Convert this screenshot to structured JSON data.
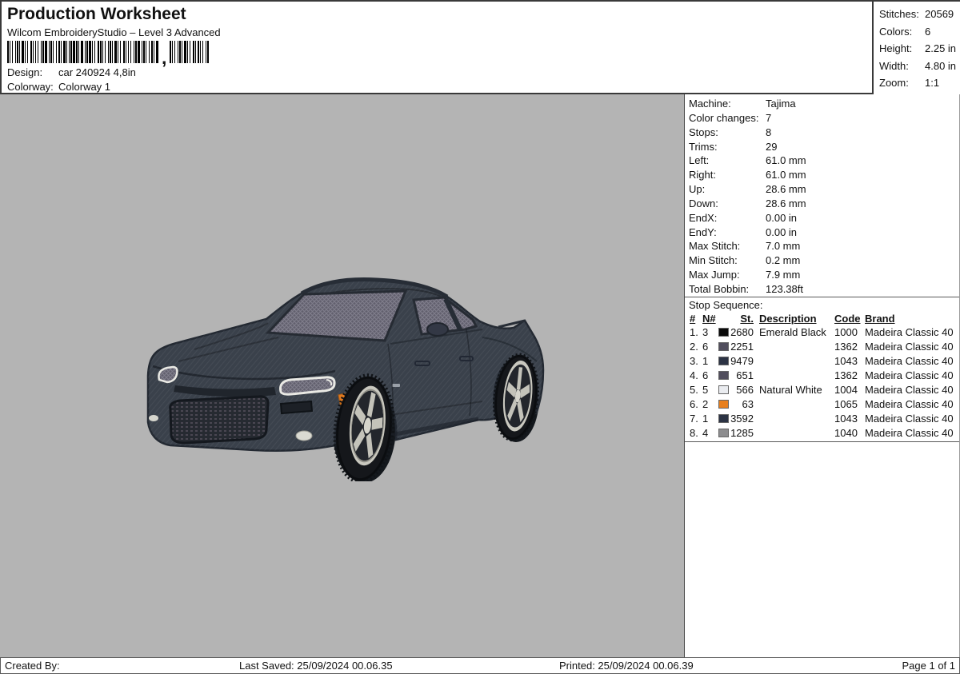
{
  "header": {
    "title": "Production Worksheet",
    "subtitle": "Wilcom EmbroideryStudio – Level 3 Advanced",
    "design": {
      "label": "Design:",
      "value": "car 240924 4,8in"
    },
    "colorway": {
      "label": "Colorway:",
      "value": "Colorway 1"
    },
    "barcode": {
      "comma": ",",
      "segment1_pattern": "211213112112311213211212131121321121131221123112112131211232112131121321",
      "segment2_pattern": "2112131121123112132112"
    }
  },
  "summary": {
    "rows": [
      {
        "label": "Stitches:",
        "value": "20569"
      },
      {
        "label": "Colors:",
        "value": "6"
      },
      {
        "label": "Height:",
        "value": "2.25 in"
      },
      {
        "label": "Width:",
        "value": "4.80 in"
      },
      {
        "label": "Zoom:",
        "value": "1:1"
      }
    ]
  },
  "machine_info": {
    "rows": [
      {
        "label": "Machine:",
        "value": "Tajima"
      },
      {
        "label": "Color changes:",
        "value": "7"
      },
      {
        "label": "Stops:",
        "value": "8"
      },
      {
        "label": "Trims:",
        "value": "29"
      },
      {
        "label": "Left:",
        "value": "61.0 mm"
      },
      {
        "label": "Right:",
        "value": "61.0 mm"
      },
      {
        "label": "Up:",
        "value": "28.6 mm"
      },
      {
        "label": "Down:",
        "value": "28.6 mm"
      },
      {
        "label": "EndX:",
        "value": "0.00 in"
      },
      {
        "label": "EndY:",
        "value": "0.00 in"
      },
      {
        "label": "Max Stitch:",
        "value": "7.0 mm"
      },
      {
        "label": "Min Stitch:",
        "value": "0.2 mm"
      },
      {
        "label": "Max Jump:",
        "value": "7.9 mm"
      },
      {
        "label": "Total Bobbin:",
        "value": "123.38ft"
      }
    ]
  },
  "stop_sequence": {
    "title": "Stop Sequence:",
    "columns": [
      "#",
      "N#",
      "St.",
      "Description",
      "Code",
      "Brand"
    ],
    "rows": [
      {
        "num": "1.",
        "needle": "3",
        "swatch": "#0a0a0a",
        "stitches": "2680",
        "description": "Emerald Black",
        "code": "1000",
        "brand": "Madeira Classic 40"
      },
      {
        "num": "2.",
        "needle": "6",
        "swatch": "#514e5d",
        "stitches": "2251",
        "description": "",
        "code": "1362",
        "brand": "Madeira Classic 40"
      },
      {
        "num": "3.",
        "needle": "1",
        "swatch": "#2c3344",
        "stitches": "9479",
        "description": "",
        "code": "1043",
        "brand": "Madeira Classic 40"
      },
      {
        "num": "4.",
        "needle": "6",
        "swatch": "#514e5d",
        "stitches": "651",
        "description": "",
        "code": "1362",
        "brand": "Madeira Classic 40"
      },
      {
        "num": "5.",
        "needle": "5",
        "swatch": "#eaecf0",
        "stitches": "566",
        "description": "Natural White",
        "code": "1004",
        "brand": "Madeira Classic 40"
      },
      {
        "num": "6.",
        "needle": "2",
        "swatch": "#e8801f",
        "stitches": "63",
        "description": "",
        "code": "1065",
        "brand": "Madeira Classic 40"
      },
      {
        "num": "7.",
        "needle": "1",
        "swatch": "#2c3344",
        "stitches": "3592",
        "description": "",
        "code": "1043",
        "brand": "Madeira Classic 40"
      },
      {
        "num": "8.",
        "needle": "4",
        "swatch": "#8d8d8f",
        "stitches": "1285",
        "description": "",
        "code": "1040",
        "brand": "Madeira Classic 40"
      }
    ]
  },
  "footer": {
    "created_by": "Created By:",
    "last_saved": "Last Saved: 25/09/2024 00.06.35",
    "printed": "Printed: 25/09/2024 00.06.39",
    "page": "Page 1 of 1"
  }
}
